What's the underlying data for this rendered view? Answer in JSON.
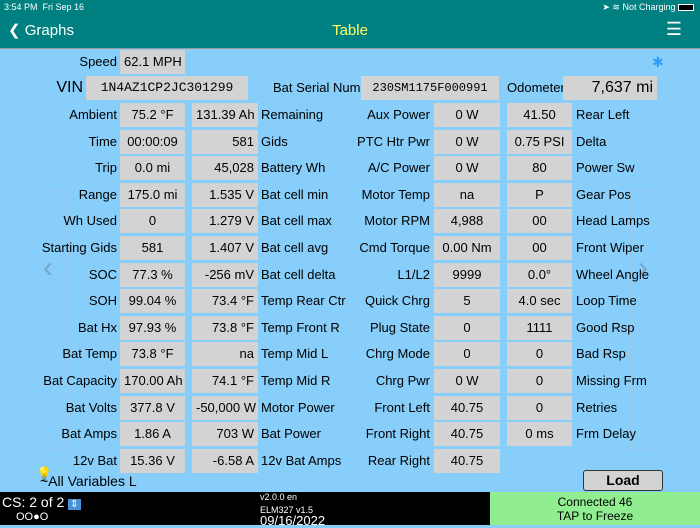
{
  "status": {
    "time": "3:54 PM",
    "date": "Fri Sep 16",
    "battery": "Not Charging"
  },
  "nav": {
    "back": "Graphs",
    "title": "Table",
    "menu": "☰"
  },
  "top": {
    "speed_label": "Speed",
    "speed": "62.1 MPH",
    "vin_label": "VIN",
    "vin": "1N4AZ1CP2JC301299",
    "serial_label": "Bat Serial Num",
    "serial": "230SM1175F000991",
    "odo_label": "Odometer",
    "odo": "7,637 mi",
    "star": "✱"
  },
  "rows": [
    [
      "Ambient",
      "75.2 °F",
      "131.39 Ah",
      "Remaining",
      "Aux Power",
      "0 W",
      "41.50",
      "Rear Left"
    ],
    [
      "Time",
      "00:00:09",
      "581",
      "Gids",
      "PTC Htr Pwr",
      "0 W",
      "0.75 PSI",
      "Delta"
    ],
    [
      "Trip",
      "0.0 mi",
      "45,028",
      "Battery Wh",
      "A/C Power",
      "0 W",
      "80",
      "Power Sw"
    ],
    [
      "Range",
      "175.0 mi",
      "1.535 V",
      "Bat cell min",
      "Motor Temp",
      "na",
      "P",
      "Gear Pos"
    ],
    [
      "Wh Used",
      "0",
      "1.279 V",
      "Bat cell max",
      "Motor RPM",
      "4,988",
      "00",
      "Head Lamps"
    ],
    [
      "Starting Gids",
      "581",
      "1.407 V",
      "Bat cell avg",
      "Cmd Torque",
      "0.00 Nm",
      "00",
      "Front Wiper"
    ],
    [
      "SOC",
      "77.3 %",
      "-256 mV",
      "Bat cell delta",
      "L1/L2",
      "9999",
      "0.0°",
      "Wheel Angle"
    ],
    [
      "SOH",
      "99.04 %",
      "73.4 °F",
      "Temp Rear Ctr",
      "Quick Chrg",
      "5",
      "4.0 sec",
      "Loop Time"
    ],
    [
      "Bat Hx",
      "97.93 %",
      "73.8 °F",
      "Temp Front R",
      "Plug State",
      "0",
      "1111",
      "Good Rsp"
    ],
    [
      "Bat Temp",
      "73.8 °F",
      "na",
      "Temp Mid L",
      "Chrg Mode",
      "0",
      "0",
      "Bad Rsp"
    ],
    [
      "Bat Capacity",
      "170.00 Ah",
      "74.1 °F",
      "Temp Mid R",
      "Chrg Pwr",
      "0 W",
      "0",
      "Missing Frm"
    ],
    [
      "Bat Volts",
      "377.8 V",
      "-50,000 W",
      "Motor Power",
      "Front Left",
      "40.75",
      "0",
      "Retries"
    ],
    [
      "Bat Amps",
      "1.86 A",
      "703 W",
      "Bat Power",
      "Front Right",
      "40.75",
      "0 ms",
      "Frm Delay"
    ],
    [
      "12v Bat",
      "15.36 V",
      "-6.58 A",
      "12v Bat Amps",
      "Rear Right",
      "40.75",
      null,
      null
    ]
  ],
  "footer": {
    "all_vars": "~All Variables L",
    "load": "Load",
    "cs": "CS: 2 of 2",
    "dots": "OO●O",
    "version": "v2.0.0 en",
    "elm": "ELM327 v1.5",
    "date": "09/16/2022",
    "connected": "Connected 46",
    "tap": "TAP to Freeze"
  }
}
